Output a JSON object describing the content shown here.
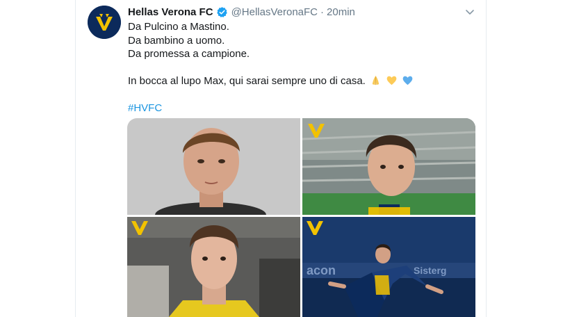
{
  "tweet": {
    "author_name": "Hellas Verona FC",
    "handle": "@HellasVeronaFC",
    "separator": "·",
    "time": "20min",
    "verified": true,
    "lines": [
      "Da Pulcino a Mastino.",
      "Da bambino a uomo.",
      "Da promessa a campione.",
      "In bocca al lupo Max, qui sarai sempre uno di casa."
    ],
    "emojis": [
      "folded-hands",
      "yellow-heart",
      "blue-heart"
    ],
    "hashtag": "#HVFC",
    "avatar_logo_text": "HELLAS VERONA FC"
  },
  "colors": {
    "club_blue": "#0c2a5b",
    "club_yellow": "#f2c200",
    "link": "#1b95e0",
    "verified": "#1da1f2",
    "muted": "#657786"
  },
  "icons": {
    "verified": "verified-badge-icon",
    "menu": "chevron-down-icon"
  }
}
